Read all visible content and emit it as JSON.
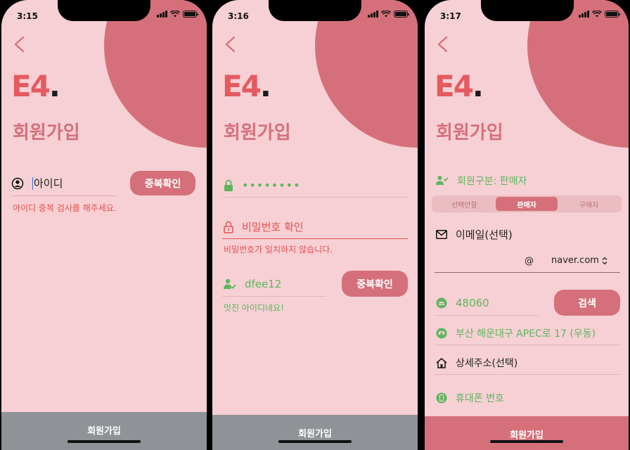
{
  "colors": {
    "background": "#f6d0d4",
    "accent": "#d5707b",
    "logo_red": "#e55a5f",
    "error": "#e55050",
    "success": "#5fb55f",
    "inactive_bar": "#8f9296"
  },
  "logo": {
    "text": "E4",
    "dot": "."
  },
  "screens": [
    {
      "time": "3:15",
      "title": "회원가입",
      "id_field": {
        "icon": "user-circle-icon",
        "placeholder": "아이디"
      },
      "dup_button": "중복확인",
      "error_msg": "아이디 중복 검사를 해주세요.",
      "bottom_button": "회원가입"
    },
    {
      "time": "3:16",
      "title": "회원가입",
      "password": {
        "icon": "lock-icon",
        "value": "••••••••"
      },
      "password_confirm": {
        "icon": "lock-open-icon",
        "placeholder": "비밀번호 확인"
      },
      "mismatch_msg": "비밀번호가 일치하지 않습니다.",
      "id_field": {
        "icon": "user-check-icon",
        "value": "dfee12"
      },
      "dup_button": "중복확인",
      "success_msg": "멋진 아이디네요!",
      "bottom_button": "회원가입"
    },
    {
      "time": "3:17",
      "title": "회원가입",
      "member_type": {
        "icon": "person-check-icon",
        "label": "회원구분: 판매자"
      },
      "segments": [
        "선택안함",
        "판매자",
        "구매자"
      ],
      "selected_segment": "판매자",
      "email": {
        "icon": "mail-icon",
        "placeholder": "이메일(선택)",
        "at": "@",
        "domain": "naver.com"
      },
      "zipcode": {
        "icon": "mailbox-icon",
        "value": "48060"
      },
      "search_button": "검색",
      "address": {
        "icon": "road-icon",
        "value": "부산 해운대구 APEC로 17 (우동)"
      },
      "address_detail": {
        "icon": "house-icon",
        "placeholder": "상세주소(선택)"
      },
      "phone": {
        "icon": "phone-icon",
        "placeholder": "휴대폰 번호"
      },
      "bottom_button": "회원가입"
    }
  ]
}
